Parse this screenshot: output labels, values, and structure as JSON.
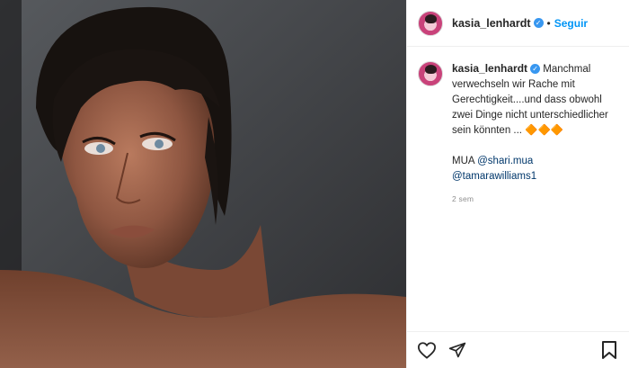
{
  "post": {
    "username": "kasia_lenhardt",
    "verified_icon": "verified-badge-icon",
    "follow_label": "Seguir",
    "separator": "•"
  },
  "caption": {
    "username": "kasia_lenhardt",
    "text": "Manchmal verwechseln wir Rache mit Gerechtigkeit....und dass obwohl zwei Dinge nicht unterschiedlicher sein könnten ...",
    "emojis": "🔶🔶🔶",
    "mua_prefix": "MUA",
    "mention_1": "@shari.mua",
    "mention_2": "@tamarawilliams1",
    "time": "2 sem"
  },
  "actions": {
    "like_icon": "heart-icon",
    "share_icon": "share-icon",
    "save_icon": "bookmark-icon"
  },
  "colors": {
    "link": "#0095f6",
    "mention": "#00376b",
    "muted": "#8e8e8e",
    "verified": "#3897f0"
  }
}
